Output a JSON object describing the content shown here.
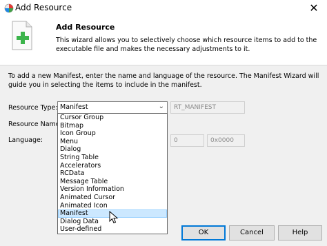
{
  "window": {
    "title": "Add Resource"
  },
  "header": {
    "title": "Add Resource",
    "description": "This wizard allows you to selectively choose which resource items to add to the executable file and makes the necessary adjustments to it."
  },
  "intro": "To add a new Manifest, enter the name and language of the resource. The Manifest Wizard will guide you in selecting the items to include in the manifest.",
  "form": {
    "resource_type_label": "Resource Type:",
    "resource_type_value": "Manifest",
    "resource_type_id": "RT_MANIFEST",
    "resource_name_label": "Resource Name:",
    "language_label": "Language:",
    "language_value": "0",
    "language_hex": "0x0000"
  },
  "dropdown": {
    "options": [
      "Cursor Group",
      "Bitmap",
      "Icon Group",
      "Menu",
      "Dialog",
      "String Table",
      "Accelerators",
      "RCData",
      "Message Table",
      "Version Information",
      "Animated Cursor",
      "Animated Icon",
      "Manifest",
      "Dialog Data",
      "User-defined"
    ],
    "selected": "Manifest"
  },
  "buttons": {
    "ok": "OK",
    "cancel": "Cancel",
    "help": "Help"
  },
  "icons": {
    "app": "app-icon",
    "header": "add-document-icon",
    "close": "close-icon",
    "arrow": "chevron-down-icon",
    "cursor": "mouse-pointer-icon"
  },
  "colors": {
    "selection": "#cce8ff",
    "accent": "#0078d7",
    "plus": "#3cb44b"
  }
}
